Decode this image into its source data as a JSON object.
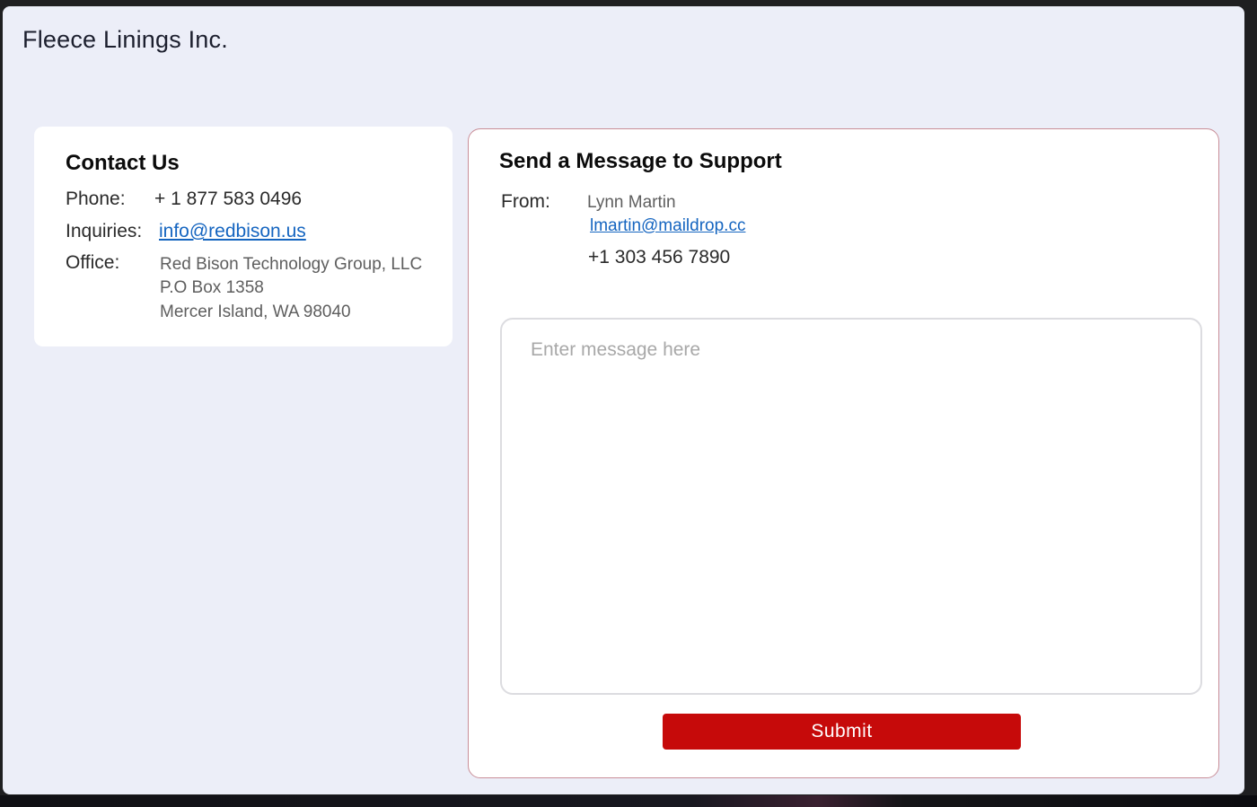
{
  "app": {
    "title": "Fleece Linings Inc."
  },
  "contact": {
    "heading": "Contact Us",
    "phone_label": "Phone:",
    "phone_value": "+ 1 877 583 0496",
    "inquiries_label": "Inquiries:",
    "inquiries_email": "info@redbison.us",
    "office_label": "Office:",
    "office_lines": [
      "Red Bison Technology Group, LLC",
      "P.O Box 1358",
      "Mercer Island, WA 98040"
    ]
  },
  "message": {
    "heading": "Send a Message to Support",
    "from_label": "From:",
    "from_name": "Lynn Martin",
    "from_email": "lmartin@maildrop.cc",
    "from_phone": "+1 303 456 7890",
    "body_value": "",
    "body_placeholder": "Enter message here",
    "submit_label": "Submit"
  },
  "colors": {
    "background": "#eceef8",
    "submit_button": "#c60a0a",
    "link": "#1565c0",
    "message_card_border": "#c98e98"
  }
}
